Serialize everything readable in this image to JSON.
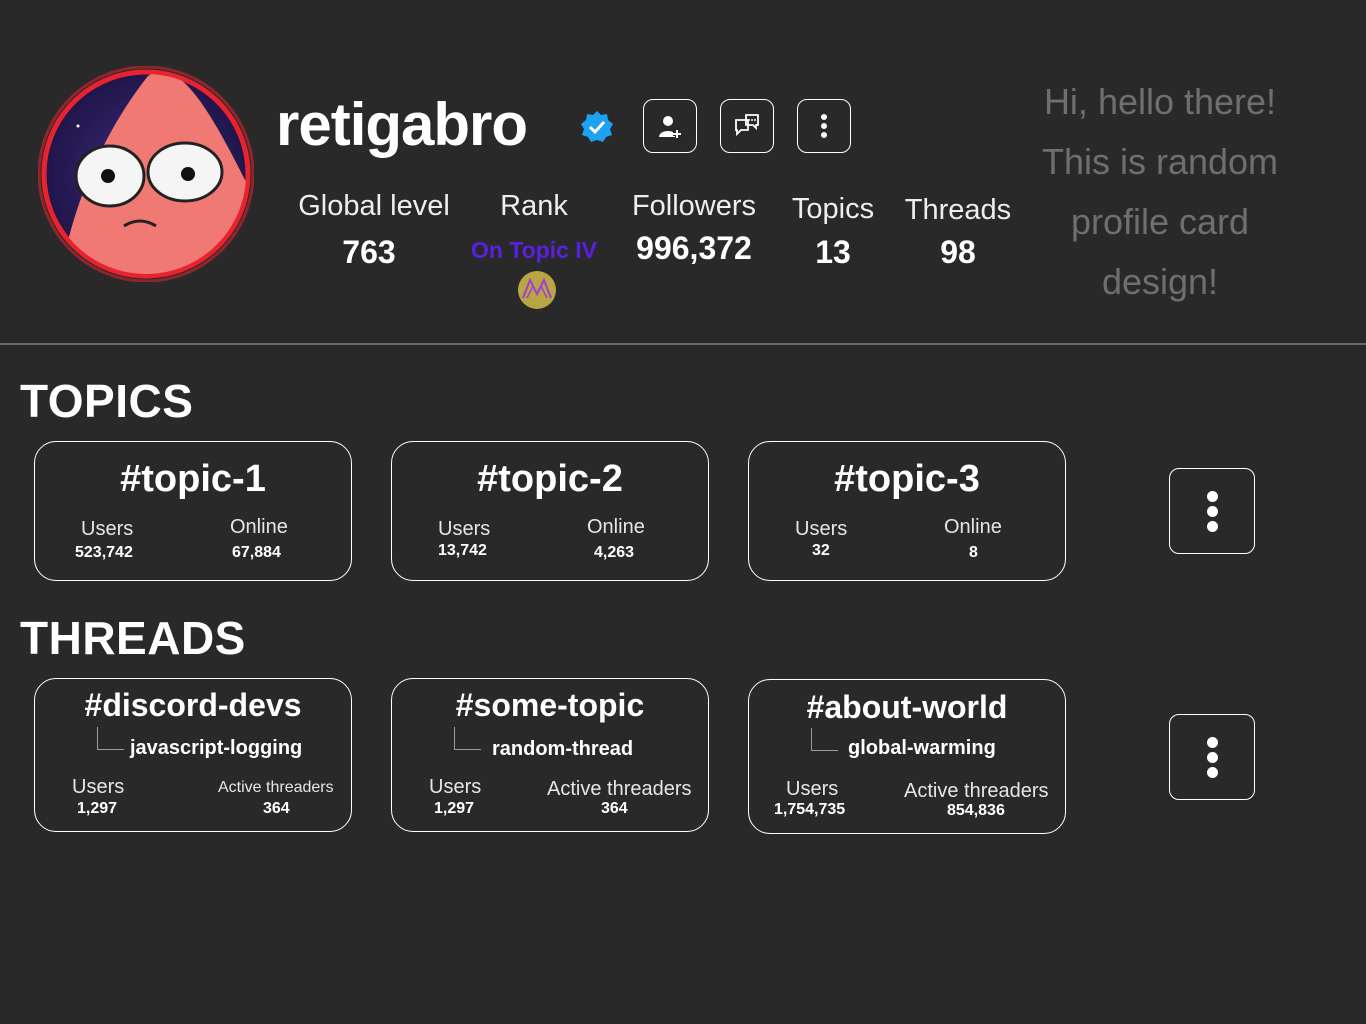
{
  "profile": {
    "username": "retigabro",
    "verified": true,
    "intro_lines": [
      "Hi, hello there!",
      "This is random",
      "profile card",
      "design!"
    ],
    "stats": {
      "global_level": {
        "label": "Global level",
        "value": "763"
      },
      "rank": {
        "label": "Rank",
        "value": "On Topic IV"
      },
      "followers": {
        "label": "Followers",
        "value": "996,372"
      },
      "topics": {
        "label": "Topics",
        "value": "13"
      },
      "threads": {
        "label": "Threads",
        "value": "98"
      }
    }
  },
  "actions": [
    "add-friend-icon",
    "message-icon",
    "more-vertical-icon"
  ],
  "topics_section": {
    "title": "TOPICS",
    "cards": [
      {
        "name": "#topic-1",
        "users_label": "Users",
        "users": "523,742",
        "online_label": "Online",
        "online": "67,884"
      },
      {
        "name": "#topic-2",
        "users_label": "Users",
        "users": "13,742",
        "online_label": "Online",
        "online": "4,263"
      },
      {
        "name": "#topic-3",
        "users_label": "Users",
        "users": "32",
        "online_label": "Online",
        "online": "8"
      }
    ]
  },
  "threads_section": {
    "title": "THREADS",
    "cards": [
      {
        "name": "#discord-devs",
        "thread": "javascript-logging",
        "users_label": "Users",
        "users": "1,297",
        "active_label": "Active threaders",
        "active": "364"
      },
      {
        "name": "#some-topic",
        "thread": "random-thread",
        "users_label": "Users",
        "users": "1,297",
        "active_label": "Active threaders",
        "active": "364"
      },
      {
        "name": "#about-world",
        "thread": "global-warming",
        "users_label": "Users",
        "users": "1,754,735",
        "active_label": "Active threaders",
        "active": "854,836"
      }
    ]
  },
  "colors": {
    "background": "#292929",
    "rank_accent": "#5b1fe0",
    "verified_badge": "#1da1f2",
    "avatar_ring": "#e8232f",
    "intro_text": "#6f6f6f"
  }
}
